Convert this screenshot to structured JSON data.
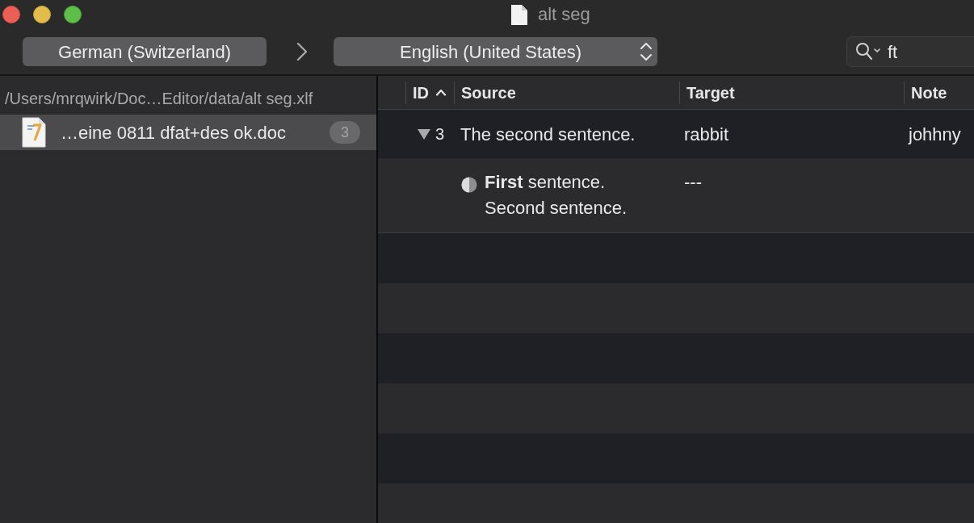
{
  "window": {
    "title": "alt seg"
  },
  "toolbar": {
    "source_language": "German (Switzerland)",
    "target_language": "English (United States)",
    "search": {
      "value": "ft"
    }
  },
  "sidebar": {
    "path": "/Users/mrqwirk/Doc…Editor/data/alt seg.xlf",
    "files": [
      {
        "name": "…eine 0811 dfat+des ok.doc",
        "count": "3",
        "selected": true
      }
    ]
  },
  "table": {
    "columns": [
      {
        "label": "ID",
        "sorted": true
      },
      {
        "label": "Source",
        "sorted": false
      },
      {
        "label": "Target",
        "sorted": false
      },
      {
        "label": "Note",
        "sorted": false
      }
    ],
    "rows": [
      {
        "id": "3",
        "expanded": true,
        "source": "The second sentence.",
        "target": "rabbit",
        "note": "johhny",
        "children": [
          {
            "partial": true,
            "source_lines": [
              "**First** sentence.",
              "Second sentence."
            ],
            "target": "---"
          }
        ]
      }
    ]
  }
}
